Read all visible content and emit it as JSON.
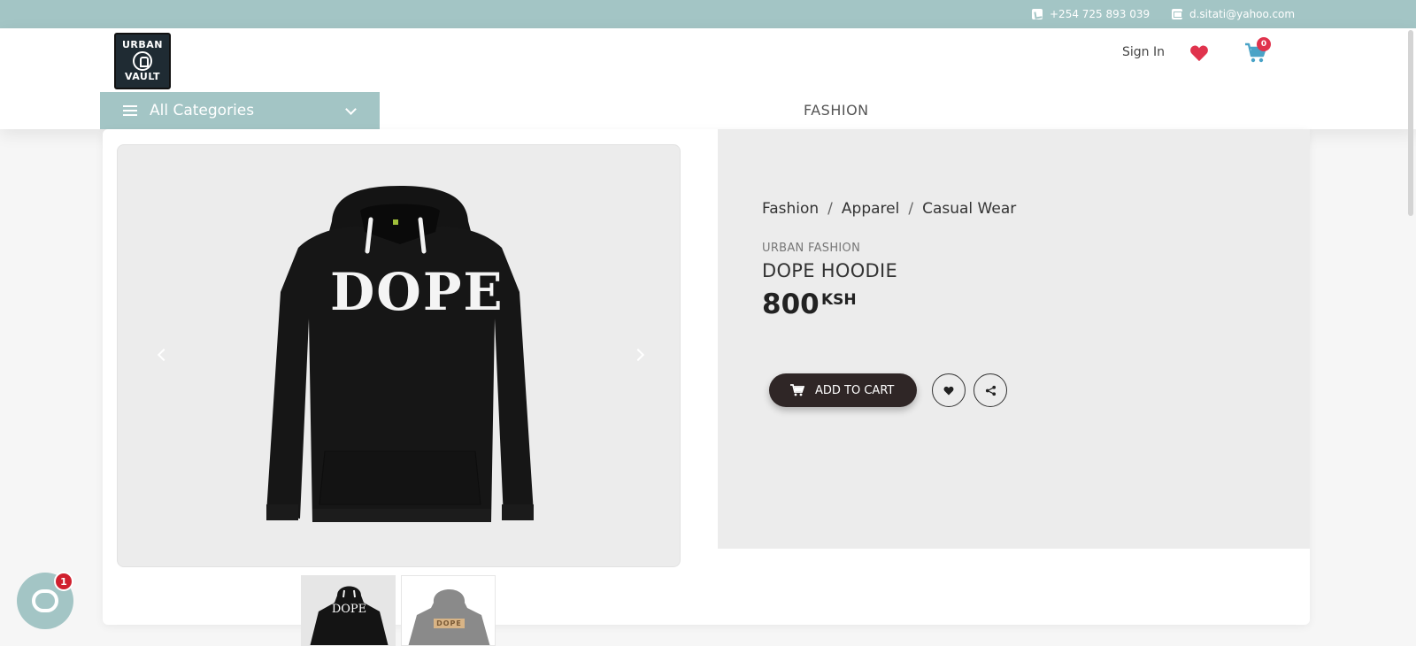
{
  "topbar": {
    "phone": "+254 725 893 039",
    "email": "d.sitati@yahoo.com",
    "phone_icon": "phone-icon",
    "email_icon": "mail-icon"
  },
  "header": {
    "logo": {
      "line1": "URBAN",
      "line2": "VAULT"
    },
    "sign_in": "Sign In",
    "cart_count": "0",
    "categories_label": "All Categories",
    "nav_items": [
      "FASHION"
    ]
  },
  "product": {
    "breadcrumb": [
      "Fashion",
      "Apparel",
      "Casual Wear"
    ],
    "brand": "URBAN FASHION",
    "name": "DOPE HOODIE",
    "price": "800",
    "currency": "KSH",
    "add_to_cart": "ADD TO CART",
    "image_text": "DOPE",
    "thumbnails": [
      {
        "text": "DOPE",
        "color": "#111111"
      },
      {
        "text": "DOPE",
        "color": "#8a8a8a"
      }
    ]
  },
  "chat": {
    "badge": "1"
  },
  "colors": {
    "accent": "#a3c5c5",
    "heart": "#e0334d",
    "cart": "#4aa3c7",
    "button_dark": "#2f2626"
  }
}
